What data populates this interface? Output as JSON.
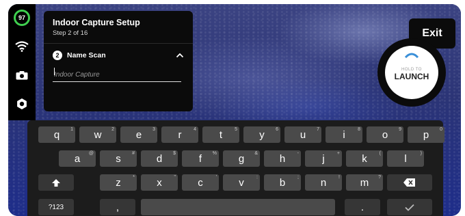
{
  "status": {
    "battery_percent": "97"
  },
  "rail": {
    "icons": [
      "wifi-icon",
      "camera-icon",
      "gear-icon"
    ]
  },
  "setup": {
    "title": "Indoor Capture Setup",
    "step": "Step 2 of 16",
    "current_step_number": "2",
    "current_step_label": "Name Scan",
    "name_placeholder": "Indoor Capture",
    "name_value": ""
  },
  "exit_label": "Exit",
  "launch": {
    "hold_label": "HOLD TO",
    "label": "LAUNCH"
  },
  "keyboard": {
    "row1": [
      {
        "k": "q",
        "h": "1"
      },
      {
        "k": "w",
        "h": "2"
      },
      {
        "k": "e",
        "h": "3"
      },
      {
        "k": "r",
        "h": "4"
      },
      {
        "k": "t",
        "h": "5"
      },
      {
        "k": "y",
        "h": "6"
      },
      {
        "k": "u",
        "h": "7"
      },
      {
        "k": "i",
        "h": "8"
      },
      {
        "k": "o",
        "h": "9"
      },
      {
        "k": "p",
        "h": "0"
      }
    ],
    "row2": [
      {
        "k": "a",
        "h": "@"
      },
      {
        "k": "s",
        "h": "#"
      },
      {
        "k": "d",
        "h": "$"
      },
      {
        "k": "f",
        "h": "%"
      },
      {
        "k": "g",
        "h": "&"
      },
      {
        "k": "h",
        "h": "-"
      },
      {
        "k": "j",
        "h": "+"
      },
      {
        "k": "k",
        "h": "("
      },
      {
        "k": "l",
        "h": ")"
      }
    ],
    "row3": [
      {
        "k": "z",
        "h": "*"
      },
      {
        "k": "x",
        "h": "\""
      },
      {
        "k": "c",
        "h": "'"
      },
      {
        "k": "v",
        "h": ":"
      },
      {
        "k": "b",
        "h": ";"
      },
      {
        "k": "n",
        "h": "!"
      },
      {
        "k": "m",
        "h": "?"
      }
    ],
    "symbols_label": "?123",
    "comma_label": ",",
    "period_label": ".",
    "shift_icon": "shift-icon",
    "backspace_icon": "backspace-icon",
    "enter_icon": "check-icon"
  }
}
